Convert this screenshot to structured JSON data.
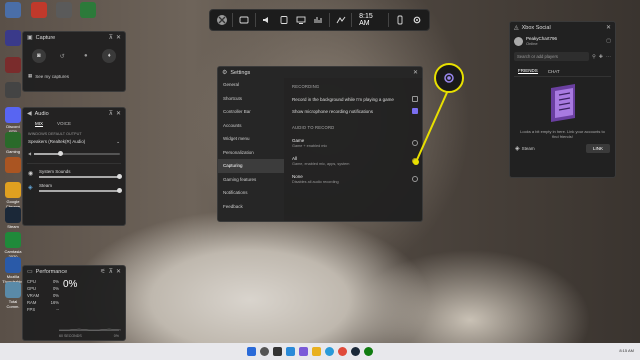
{
  "desktop": {
    "icons": [
      {
        "label": "",
        "color": "#4a6ea8"
      },
      {
        "label": "",
        "color": "#c0392b"
      },
      {
        "label": "",
        "color": "#5a5a5a"
      },
      {
        "label": "",
        "color": "#2c7a3a"
      },
      {
        "label": "",
        "color": "#3a3a8a"
      },
      {
        "label": "",
        "color": "#7a2c2c"
      },
      {
        "label": "",
        "color": "#444"
      },
      {
        "label": "Discord PTB",
        "color": "#5865f2"
      },
      {
        "label": "Gaming",
        "color": "#2a6a2a"
      },
      {
        "label": "",
        "color": "#aa5522"
      },
      {
        "label": "Google Chrome",
        "color": "#e0a020"
      },
      {
        "label": "Steam",
        "color": "#1b2838"
      },
      {
        "label": "Camtasia 2020",
        "color": "#1f8a3a"
      },
      {
        "label": "Mozilla Thunderbird",
        "color": "#2a5aa8"
      },
      {
        "label": "Total Comm.",
        "color": "#5a8aa8"
      }
    ]
  },
  "gamebar": {
    "time": "8:15 AM"
  },
  "capture": {
    "title": "Capture",
    "see_captures": "See my captures"
  },
  "audio": {
    "title": "Audio",
    "tabs": [
      "MIX",
      "VOICE"
    ],
    "default_output_label": "WINDOWS DEFAULT OUTPUT",
    "device": "Speakers (Realtek(R) Audio)",
    "master_level": 0.3,
    "apps": [
      {
        "name": "System Sounds",
        "level": 1.0
      },
      {
        "name": "Steam",
        "level": 1.0
      }
    ]
  },
  "performance": {
    "title": "Performance",
    "metrics": [
      {
        "label": "CPU",
        "value": "0%"
      },
      {
        "label": "GPU",
        "value": "0%"
      },
      {
        "label": "VRAM",
        "value": "0%"
      },
      {
        "label": "RAM",
        "value": "16%"
      },
      {
        "label": "FPS",
        "value": "--"
      }
    ],
    "big_value": "0%",
    "sub_value": "",
    "footer_left": "60 SECONDS",
    "footer_right": "0%"
  },
  "settings": {
    "title": "Settings",
    "nav": [
      "General",
      "Shortcuts",
      "Controller Bar",
      "Accounts",
      "Widget menu",
      "Personalization",
      "Capturing",
      "Gaming features",
      "Notifications",
      "Feedback"
    ],
    "active_index": 6,
    "recording_header": "RECORDING",
    "record_bg": "Record in the background while I'm playing a game",
    "show_mic": "Show microphone recording notifications",
    "record_bg_checked": false,
    "show_mic_checked": true,
    "audio_header": "AUDIO TO RECORD",
    "options": [
      {
        "title": "Game",
        "desc": "Game + enabled mic",
        "selected": false
      },
      {
        "title": "All",
        "desc": "Game, enabled mic, apps, system",
        "selected": true
      },
      {
        "title": "None",
        "desc": "Disables all audio recording",
        "selected": false
      }
    ]
  },
  "social": {
    "title": "Xbox Social",
    "username": "PeakyChart796",
    "status": "Online",
    "search_placeholder": "Search or add players",
    "tabs": [
      "FRIENDS",
      "CHAT"
    ],
    "empty_text": "Looks a bit empty in here. Link your accounts to find friends!",
    "link_label": "LINK",
    "steam_label": "Steam"
  },
  "colors": {
    "accent": "#7a6ef0",
    "highlight": "#e8e000"
  }
}
